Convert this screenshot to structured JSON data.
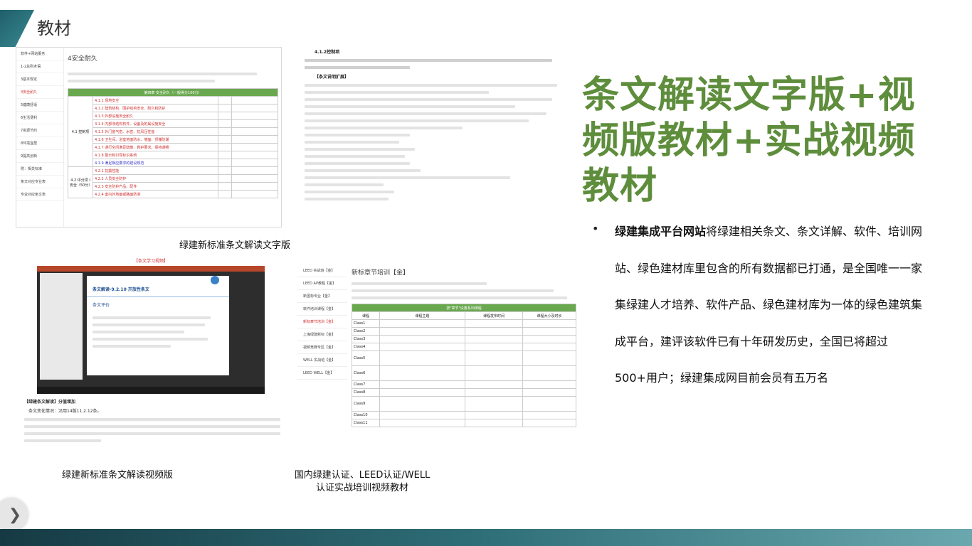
{
  "header": {
    "title": "教材"
  },
  "heading": "条文解读文字版+视频版教材+实战视频教材",
  "description": {
    "bold": "绿建集成平台网站",
    "text": "将绿建相关条文、条文详解、软件、培训网站、绿色建材库里包含的所有数据都已打通，是全国唯一一家集绿建人才培养、软件产品、绿色建材库为一体的绿色建筑集成平台，建评该软件已有十年研发历史，全国已将超过500+用户；绿建集成网目前会员有五万名"
  },
  "captions": {
    "text_version": "绿建新标准条文解读文字版",
    "video_version": "绿建新标准条文解读视频版",
    "leed_line1": "国内绿建认证、LEED认证/WELL",
    "leed_line2": "认证实战培训视频教材"
  },
  "doc1": {
    "title": "4安全耐久",
    "sidebar": [
      "软件+网站服务",
      "1-2总则术语",
      "3基本规定",
      "4安全耐久",
      "5健康舒适",
      "6生活便利",
      "7资源节约",
      "8环境宜居",
      "9提高创新",
      "附：相关标准",
      "条文对应专业表",
      "专业对应条文表"
    ],
    "table_header": "第四章 安全耐久（一般得分100分）",
    "rows": [
      "4.1.1 场地安全",
      "4.1.2 建筑结构、围护结构安全、耐久和防护",
      "4.1.3 外部设施安全耐久",
      "4.1.4 内部非结构构件、设备及附属设施安全",
      "4.1.5 外门窗气密、水密、抗风压性能",
      "4.1.6 卫生间、浴室地面防水、墙面、顶棚防潮",
      "4.1.7 通行空间满足疏散、救护要求、保持通畅",
      "4.1.8 警示和引导标识系统",
      "4.1.9 满足相应要求的建设规范",
      "4.2.1 抗震性能",
      "4.2.2 人员安全防护",
      "4.2.3 安全防护产品、配件",
      "4.2.4 室内外地面或路面防滑"
    ],
    "group1": "4.1 控制项",
    "group2": "4.2 评分项 Ⅰ 安全（50分）"
  },
  "doc2": {
    "heading": "4.1.2控制项",
    "subheading": "【条文说明扩展】"
  },
  "video": {
    "title": "【条文学习视频】",
    "slide_title": "条文解读-9.2.10 开放性条文",
    "slide_sub": "条文评价",
    "notes_title": "【绿建条文解读】分值增加",
    "notes_sub": "条文变化情况：沿用14版11.2.12条。"
  },
  "leed": {
    "title": "新标章节培训【金】",
    "sidebar": [
      "LEED 实战班【金】",
      "LEED AP教程【金】",
      "新国标专业【金】",
      "软件培训课程【金】",
      "新标章节培训【金】",
      "上海绿建新标【金】",
      "视频竞赛专区【金】",
      "WELL 实战班【金】",
      "LEED WELL【金】"
    ],
    "table_header": "按\"章节\"设置系列课程",
    "columns": [
      "课程",
      "课程主题",
      "课程发布时间",
      "课程大小及时长"
    ],
    "classes": [
      "Class1",
      "Class2",
      "Class3",
      "Class4",
      "Class5",
      "Class6",
      "Class7",
      "Class8",
      "Class9",
      "Class10",
      "Class11"
    ]
  },
  "nav": {
    "next": "❯"
  }
}
